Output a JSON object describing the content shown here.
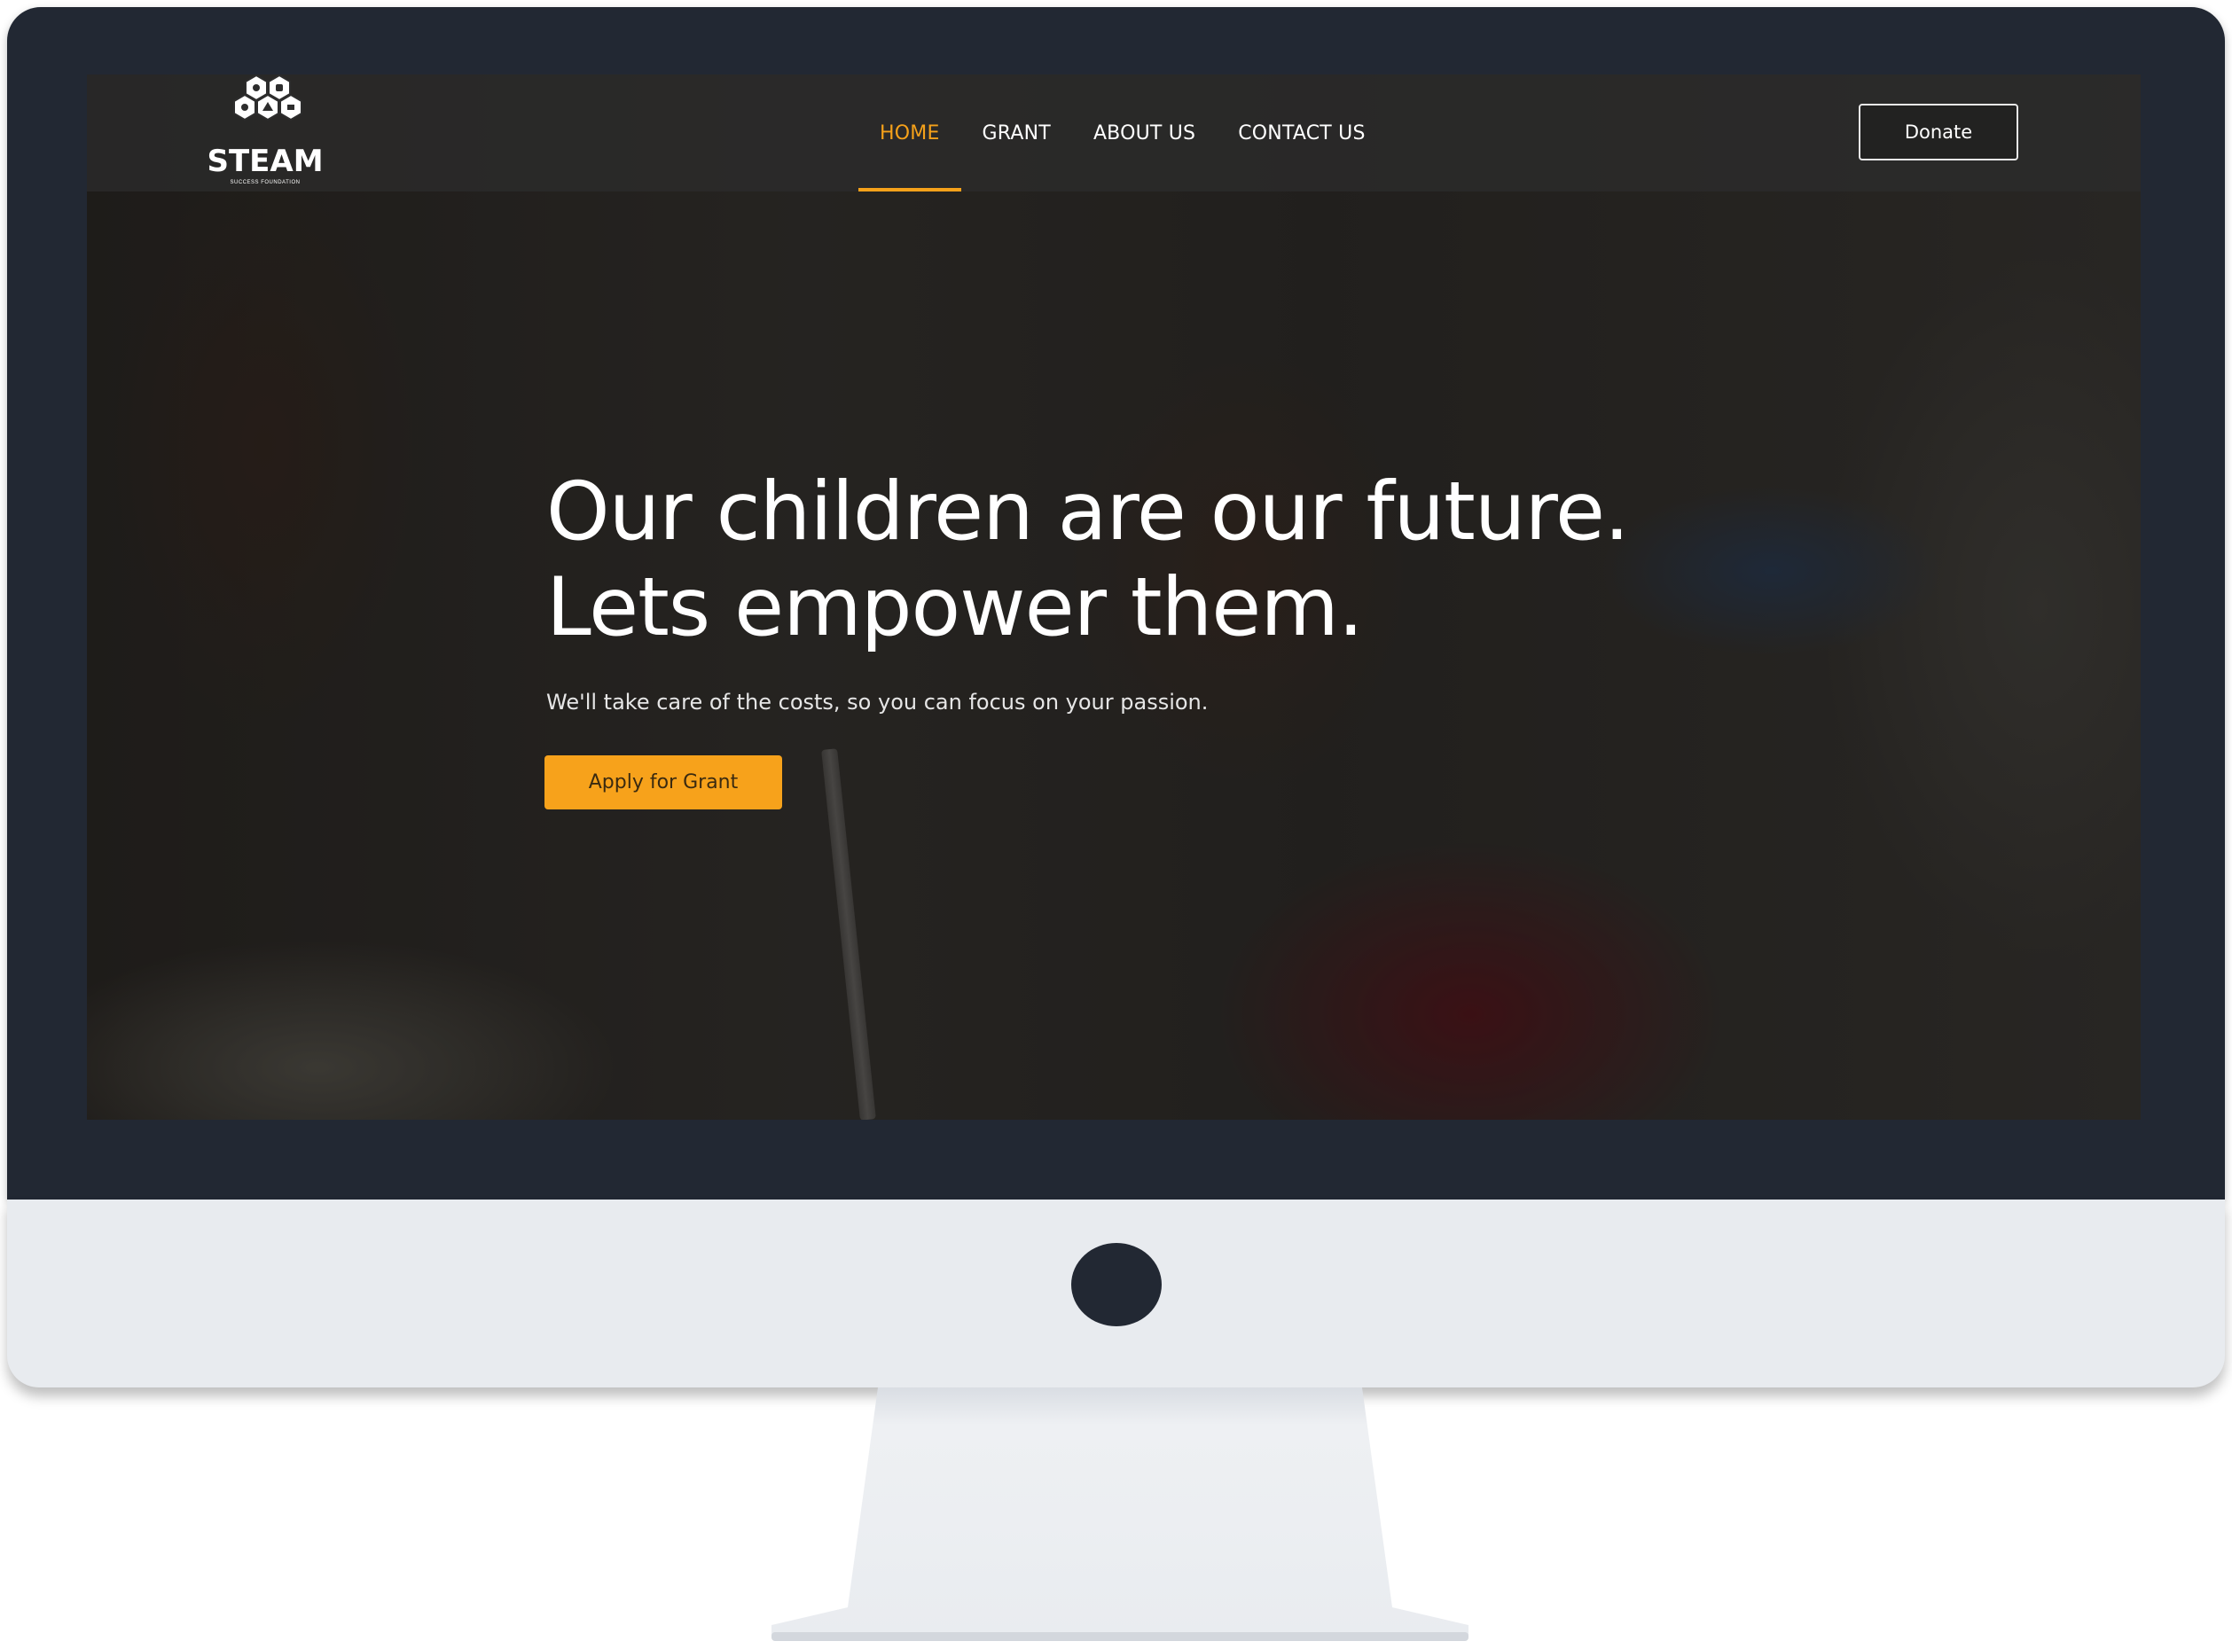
{
  "brand": {
    "logo_word": "STEAM",
    "logo_subtext": "SUCCESS FOUNDATION"
  },
  "nav": {
    "items": [
      {
        "label": "HOME",
        "active": true
      },
      {
        "label": "GRANT",
        "active": false
      },
      {
        "label": "ABOUT US",
        "active": false
      },
      {
        "label": "CONTACT US",
        "active": false
      }
    ],
    "donate_label": "Donate"
  },
  "hero": {
    "title_line1": "Our children are our future.",
    "title_line2": "Lets empower them.",
    "subtitle": "We'll take care of the costs, so you can focus on your passion.",
    "cta_label": "Apply for Grant"
  },
  "colors": {
    "accent": "#f7a21b",
    "bezel": "#222833",
    "chin": "#e8ebef",
    "nav_overlay": "#2d2d2d"
  },
  "icons": {
    "logo_hexagons": "hexagon-cluster-icon"
  }
}
